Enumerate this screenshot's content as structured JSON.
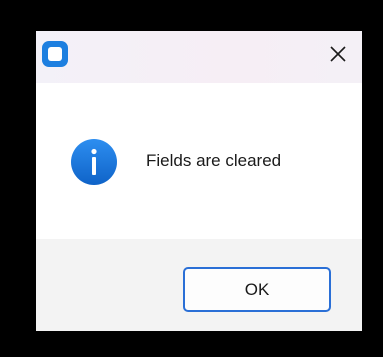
{
  "dialog": {
    "app_icon": "app-icon",
    "close_icon": "close-icon",
    "info_icon": "info-icon",
    "message": "Fields are cleared",
    "ok_label": "OK"
  },
  "colors": {
    "accent": "#2a6fd6",
    "info_blue": "#1a73d9",
    "footer_bg": "#f3f3f3",
    "frame": "#000000"
  }
}
